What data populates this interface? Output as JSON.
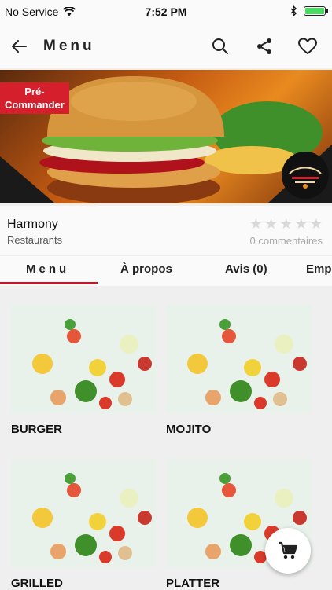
{
  "status_bar": {
    "carrier": "No Service",
    "time": "7:52 PM",
    "battery_level": 1.0
  },
  "app_bar": {
    "title": "Menu",
    "icons": [
      "back-arrow-icon",
      "search-icon",
      "share-icon",
      "heart-icon"
    ]
  },
  "hero": {
    "badge": "Pré-\nCommander"
  },
  "restaurant": {
    "name": "Harmony",
    "category": "Restaurants",
    "rating": 0,
    "comments": "0 commentaires"
  },
  "tabs": [
    {
      "label": "Menu"
    },
    {
      "label": "À propos"
    },
    {
      "label": "Avis (0)"
    },
    {
      "label": "Emp"
    }
  ],
  "menu_items": [
    {
      "label": "BURGER"
    },
    {
      "label": "MOJITO"
    },
    {
      "label": "GRILLED"
    },
    {
      "label": "PLATTER"
    }
  ],
  "colors": {
    "accent": "#c4162a",
    "badge": "#d61f2c",
    "battery": "#4cd964"
  },
  "fab": {
    "icon": "cart-icon"
  }
}
